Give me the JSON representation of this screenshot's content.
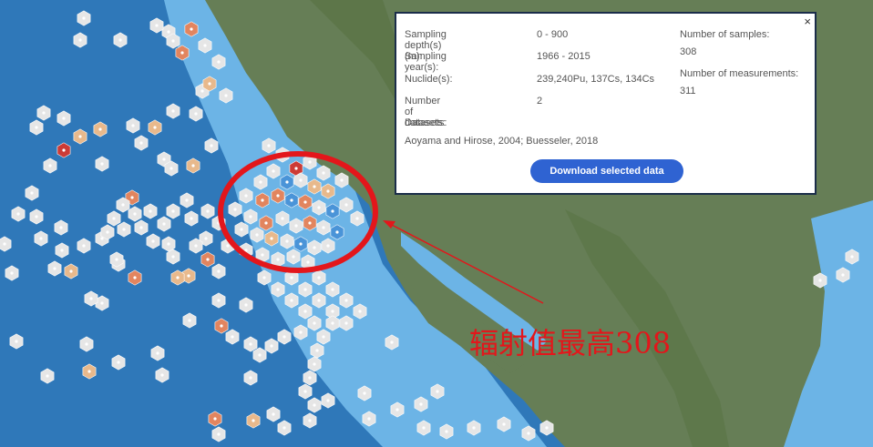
{
  "popup": {
    "close_label": "×",
    "depth_label": "Sampling depth(s) (m):",
    "depth_value": "0 - 900",
    "year_label": "Sampling year(s):",
    "year_value": "1966 - 2015",
    "nuclide_label": "Nuclide(s):",
    "nuclide_value": "239,240Pu, 137Cs, 134Cs",
    "datasets_count_label": "Number of datasets:",
    "datasets_count_value": "2",
    "datasets_label": "Datasets:",
    "datasets_value": "Aoyama and Hirose, 2004; Buesseler, 2018",
    "samples_label": "Number of samples:",
    "samples_value": "308",
    "measurements_label": "Number of measurements:",
    "measurements_value": "311",
    "download_label": "Download selected data"
  },
  "annotation": {
    "text": "辐射值最高308"
  },
  "colors": {
    "ocean_deep": "#2f78b9",
    "ocean_shelf": "#6cb4e6",
    "land": "#667e56",
    "hex_neutral": "#e6e6e6",
    "hex_low": "#e8b98c",
    "hex_mid": "#e2855f",
    "hex_high": "#cc3b36",
    "hex_blue": "#4a94d8",
    "annotation_red": "#e3161b",
    "button_blue": "#2f63d2"
  }
}
